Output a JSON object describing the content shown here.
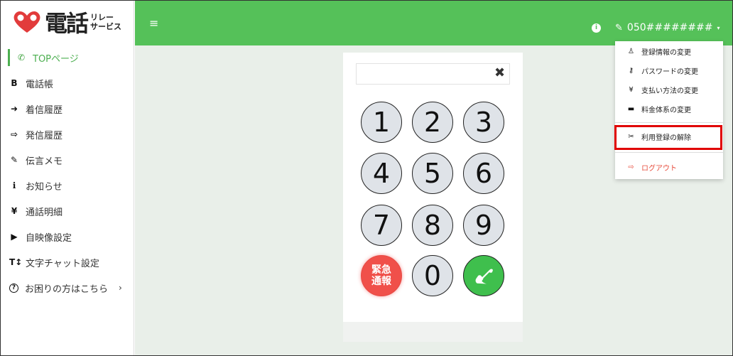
{
  "logo": {
    "main": "電話",
    "sub1": "リレー",
    "sub2": "サービス"
  },
  "sidebar": {
    "items": [
      {
        "label": "TOPページ",
        "icon": "phone-icon",
        "glyph": "✆"
      },
      {
        "label": "電話帳",
        "icon": "address-book-icon",
        "glyph": "B"
      },
      {
        "label": "着信履歴",
        "icon": "incoming-icon",
        "glyph": "➜"
      },
      {
        "label": "発信履歴",
        "icon": "outgoing-icon",
        "glyph": "⇨"
      },
      {
        "label": "伝言メモ",
        "icon": "edit-icon",
        "glyph": "✎"
      },
      {
        "label": "お知らせ",
        "icon": "info-icon",
        "glyph": "ℹ"
      },
      {
        "label": "通話明細",
        "icon": "yen-icon",
        "glyph": "¥"
      },
      {
        "label": "自映像設定",
        "icon": "video-icon",
        "glyph": "▶"
      },
      {
        "label": "文字チャット設定",
        "icon": "text-size-icon",
        "glyph": "T↕"
      },
      {
        "label": "お困りの方はこちら",
        "icon": "help-icon",
        "glyph": "?",
        "chevron": "›"
      }
    ]
  },
  "topbar": {
    "menu_glyph": "≡",
    "info_glyph": "i",
    "edit_glyph": "✎",
    "phone_number": "050########",
    "caret": "▾"
  },
  "dialer": {
    "input_value": "",
    "clear_glyph": "✖",
    "keys": [
      "1",
      "2",
      "3",
      "4",
      "5",
      "6",
      "7",
      "8",
      "9",
      "0"
    ],
    "emergency_label_1": "緊急",
    "emergency_label_2": "通報",
    "call_glyph": "✆"
  },
  "dropdown": {
    "items": [
      {
        "label": "登録情報の変更",
        "icon": "user-icon",
        "glyph": "♙"
      },
      {
        "label": "パスワードの変更",
        "icon": "key-icon",
        "glyph": "⚷"
      },
      {
        "label": "支払い方法の変更",
        "icon": "yen-icon",
        "glyph": "¥"
      },
      {
        "label": "料金体系の変更",
        "icon": "wallet-icon",
        "glyph": "▬"
      },
      {
        "label": "利用登録の解除",
        "icon": "user-slash-icon",
        "glyph": "✂"
      },
      {
        "label": "ログアウト",
        "icon": "logout-icon",
        "glyph": "⇨"
      }
    ]
  },
  "colors": {
    "accent": "#55c159",
    "emergency": "#f0504a",
    "highlight": "#e00000",
    "logout": "#e74c3c"
  }
}
